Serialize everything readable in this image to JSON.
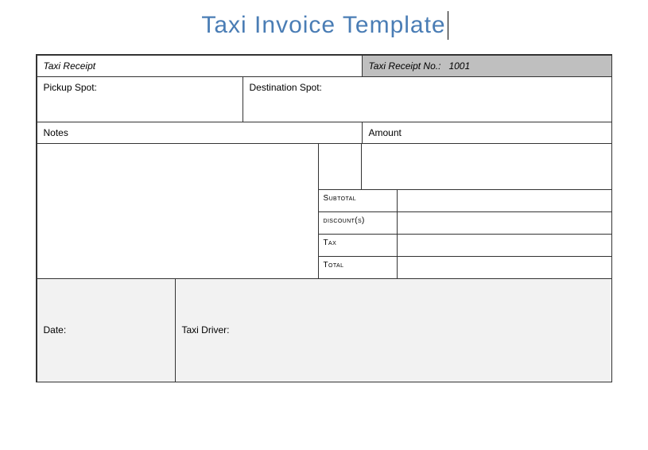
{
  "title": "Taxi Invoice Template",
  "header": {
    "receipt_label": "Taxi Receipt",
    "receipt_no_label": "Taxi Receipt No.:",
    "receipt_no_value": "1001"
  },
  "spots": {
    "pickup_label": "Pickup Spot:",
    "destination_label": "Destination Spot:"
  },
  "columns": {
    "notes": "Notes",
    "amount": "Amount"
  },
  "calc": {
    "subtotal": "Subtotal",
    "discount": "discount(s)",
    "tax": "Tax",
    "total": "Total"
  },
  "footer": {
    "date_label": "Date:",
    "driver_label": "Taxi Driver:"
  }
}
